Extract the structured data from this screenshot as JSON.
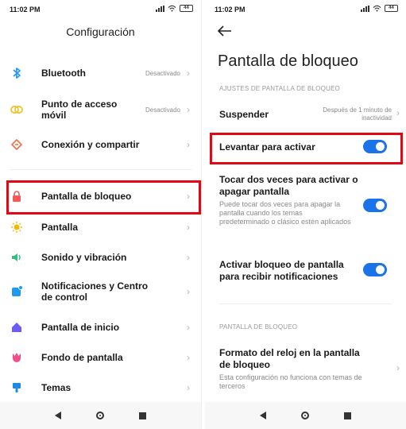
{
  "status": {
    "time": "11:02 PM",
    "battery": "44"
  },
  "left": {
    "title": "Configuración",
    "items": [
      {
        "label": "Bluetooth",
        "value": "Desactivado",
        "icon": "bluetooth-icon",
        "color": "#2196f3"
      },
      {
        "label": "Punto de acceso móvil",
        "value": "Desactivado",
        "icon": "hotspot-icon",
        "color": "#f0c020"
      },
      {
        "label": "Conexión y compartir",
        "value": "",
        "icon": "share-icon",
        "color": "#f06d4b"
      },
      {
        "label": "Pantalla de bloqueo",
        "value": "",
        "icon": "lock-icon",
        "color": "#f45a5a"
      },
      {
        "label": "Pantalla",
        "value": "",
        "icon": "sun-icon",
        "color": "#f5b800"
      },
      {
        "label": "Sonido y vibración",
        "value": "",
        "icon": "speaker-icon",
        "color": "#2ec27e"
      },
      {
        "label": "Notificaciones y Centro de control",
        "value": "",
        "icon": "notification-icon",
        "color": "#1e9bf0"
      },
      {
        "label": "Pantalla de inicio",
        "value": "",
        "icon": "home-icon",
        "color": "#6a5cf5"
      },
      {
        "label": "Fondo de pantalla",
        "value": "",
        "icon": "tulip-icon",
        "color": "#f0508c"
      },
      {
        "label": "Temas",
        "value": "",
        "icon": "brush-icon",
        "color": "#1e88e5"
      }
    ]
  },
  "right": {
    "title": "Pantalla de bloqueo",
    "section1": "AJUSTES DE PANTALLA DE BLOQUEO",
    "suspend": {
      "label": "Suspender",
      "value": "Después de 1 minuto de inactividad"
    },
    "raise": {
      "label": "Levantar para activar",
      "on": true
    },
    "double_tap": {
      "label": "Tocar dos veces para activar o apagar pantalla",
      "desc": "Puede tocar dos veces para apagar la pantalla cuando los temas predeterminado o clásico estén aplicados",
      "on": true
    },
    "notif": {
      "label": "Activar bloqueo de pantalla para recibir notificaciones",
      "on": true
    },
    "section2": "PANTALLA DE BLOQUEO",
    "clock": {
      "label": "Formato del reloj en la pantalla de bloqueo",
      "desc": "Esta configuración no funciona con temas de terceros"
    }
  },
  "colors": {
    "accent": "#1a73e8",
    "highlight": "#e30613"
  }
}
